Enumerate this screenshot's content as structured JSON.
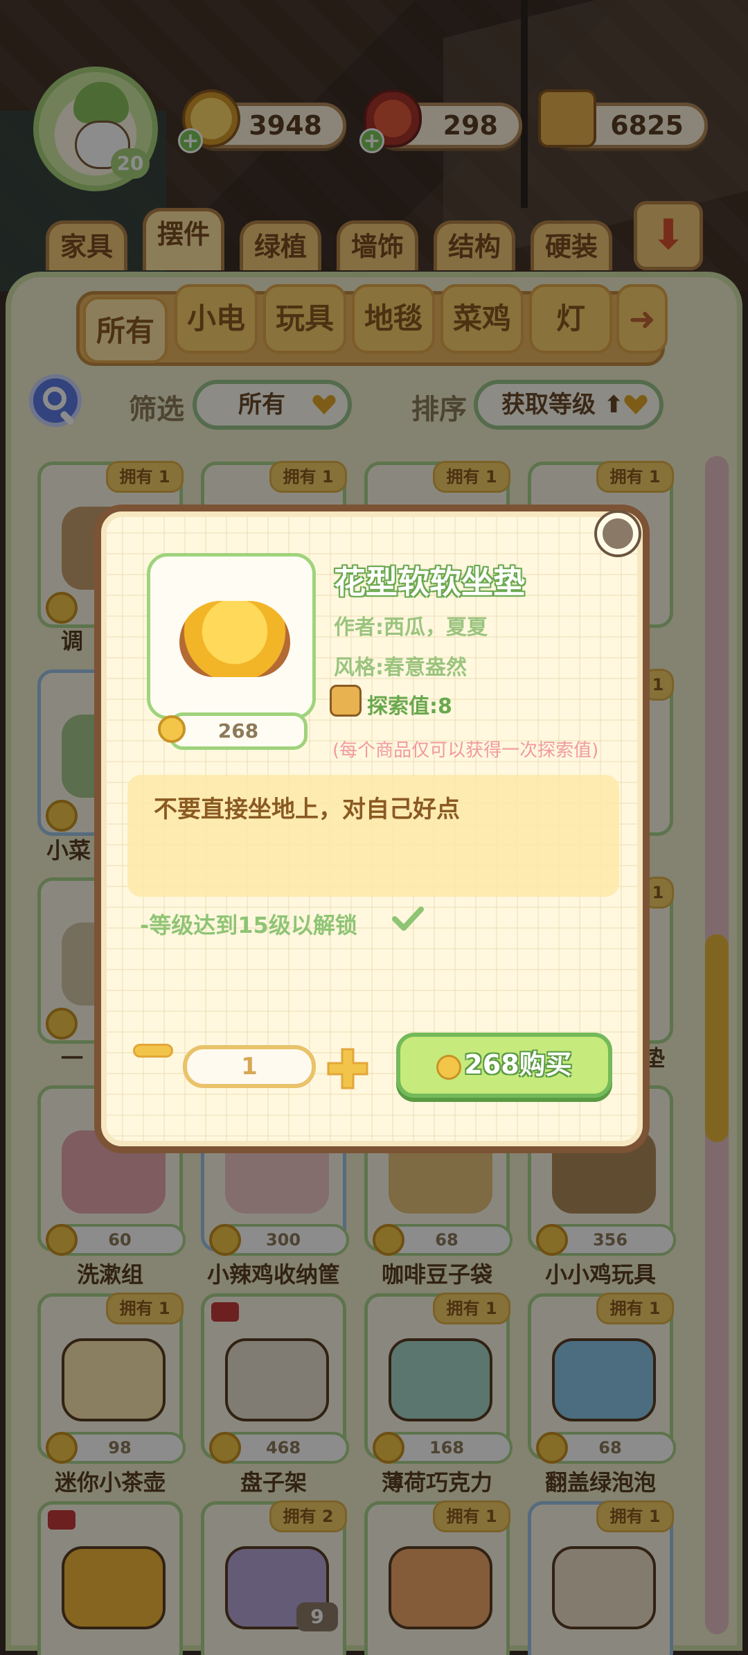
{
  "hud": {
    "avatar_level": "20",
    "currencies": [
      {
        "icon": "gold-coin-icon",
        "value": "3948"
      },
      {
        "icon": "chili-icon",
        "value": "298"
      },
      {
        "icon": "exploration-book-icon",
        "value": "6825"
      }
    ]
  },
  "categories": [
    "家具",
    "摆件",
    "绿植",
    "墙饰",
    "结构",
    "硬装"
  ],
  "active_category": "摆件",
  "sub_categories": [
    "所有",
    "小电",
    "玩具",
    "地毯",
    "菜鸡",
    "灯"
  ],
  "active_sub_category": "所有",
  "filter": {
    "label": "筛选",
    "value": "所有"
  },
  "sort": {
    "label": "排序",
    "value": "获取等级 ⬆"
  },
  "items": [
    {
      "name": "调",
      "price": "",
      "owned": "拥有 1"
    },
    {
      "name": "",
      "price": "",
      "owned": "拥有 1"
    },
    {
      "name": "",
      "price": "",
      "owned": "拥有 1"
    },
    {
      "name": "",
      "price": "",
      "owned": "拥有 1"
    },
    {
      "name": "小菜",
      "price": "",
      "owned": ""
    },
    {
      "name": "",
      "price": "",
      "owned": ""
    },
    {
      "name": "",
      "price": "",
      "owned": ""
    },
    {
      "name": "",
      "price": "",
      "owned": "1"
    },
    {
      "name": "一",
      "price": "",
      "owned": ""
    },
    {
      "name": "",
      "price": "",
      "owned": ""
    },
    {
      "name": "",
      "price": "",
      "owned": ""
    },
    {
      "name": "垫",
      "price": "",
      "owned": "1"
    },
    {
      "name": "洗漱组",
      "price": "60",
      "owned": ""
    },
    {
      "name": "小辣鸡收纳筐",
      "price": "300",
      "owned": ""
    },
    {
      "name": "咖啡豆子袋",
      "price": "68",
      "owned": ""
    },
    {
      "name": "小小鸡玩具",
      "price": "356",
      "owned": ""
    },
    {
      "name": "迷你小茶壶",
      "price": "98",
      "owned": "拥有 1"
    },
    {
      "name": "盘子架",
      "price": "468",
      "owned": ""
    },
    {
      "name": "薄荷巧克力",
      "price": "168",
      "owned": "拥有 1"
    },
    {
      "name": "翻盖绿泡泡",
      "price": "68",
      "owned": "拥有 1"
    },
    {
      "name": "",
      "price": "",
      "owned": ""
    },
    {
      "name": "",
      "price": "",
      "owned": "拥有 2"
    },
    {
      "name": "",
      "price": "",
      "owned": "拥有 1"
    },
    {
      "name": "",
      "price": "",
      "owned": "拥有 1"
    }
  ],
  "page_badge": "9",
  "modal": {
    "title": "花型软软坐垫",
    "author": "作者:西瓜，夏夏",
    "style": "风格:春意盎然",
    "explore": "探索值:8",
    "note": "(每个商品仅可以获得一次探索值)",
    "price": "268",
    "description": "不要直接坐地上，对自己好点",
    "requirement": "-等级达到15级以解锁",
    "quantity": "1",
    "buy_label": "268购买"
  },
  "colors": {
    "accent_green": "#9fd37c",
    "gold": "#f3c64a",
    "panel": "#f0edcc"
  }
}
